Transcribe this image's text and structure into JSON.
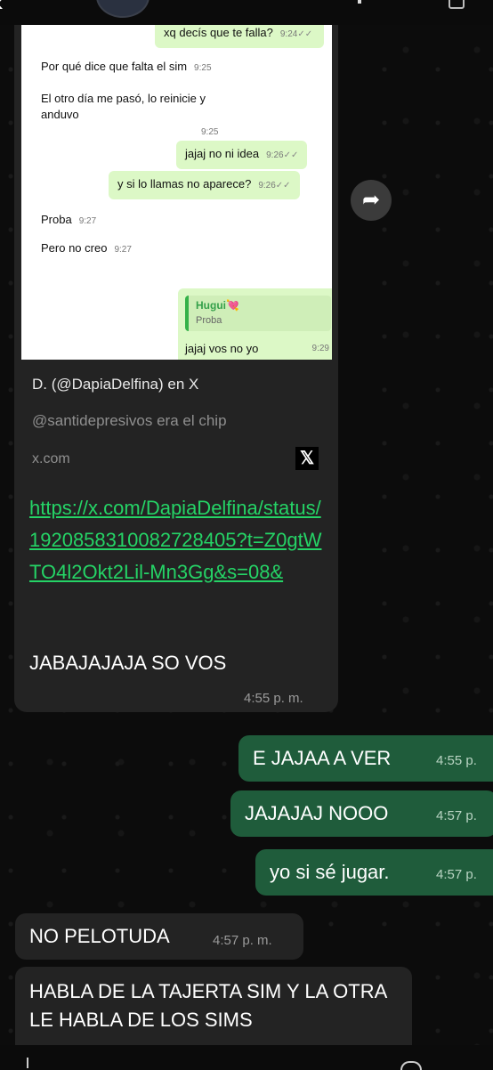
{
  "header": {
    "back_icon": "chevron-left-icon"
  },
  "preview": {
    "messages": [
      {
        "text": "xq decís que te falla?",
        "time": "9:24",
        "dir": "out"
      },
      {
        "text": "Por qué dice que falta el sim",
        "time": "9:25",
        "dir": "in"
      },
      {
        "text": "El otro día me pasó, lo reinicie y anduvo",
        "time": "9:25",
        "dir": "in"
      },
      {
        "text": "jajaj no ni idea",
        "time": "9:26",
        "dir": "out"
      },
      {
        "text": "y si lo llamas no aparece?",
        "time": "9:26",
        "dir": "out"
      },
      {
        "text": "Proba",
        "time": "9:27",
        "dir": "in"
      },
      {
        "text": "Pero no creo",
        "time": "9:27",
        "dir": "in"
      }
    ],
    "quote_name": "Hugui💘",
    "quote_text": "Proba",
    "quote_reply": "jajaj vos no yo",
    "quote_time": "9:29"
  },
  "link": {
    "title": "D. (@DapiaDelfina) en X",
    "description": "@santidepresivos era el chip",
    "domain": "x.com",
    "logo": "𝕏",
    "url": "https://x.com/DapiaDelfina/status/1920858310082728405?t=Z0gtWTO4l2Okt2Lil-Mn3Gg&s=08&"
  },
  "messages": {
    "link_msg_text": "JABAJAJAJA SO VOS",
    "link_msg_time": "4:55 p. m.",
    "out1_text": "E JAJAA A VER",
    "out1_time": "4:55 p.",
    "out2_text": "JAJAJAJ NOOO",
    "out2_time": "4:57 p.",
    "out3_text": "yo si sé jugar.",
    "out3_time": "4:57 p.",
    "in1_text": "NO PELOTUDA",
    "in1_time": "4:57 p. m.",
    "in2_text": "HABLA DE LA TAJERTA SIM Y LA OTRA LE HABLA DE LOS SIMS"
  },
  "colors": {
    "outgoing": "#1f5c3b",
    "incoming": "#232323",
    "link": "#25d366"
  },
  "forward_icon": "forward-arrow-icon"
}
